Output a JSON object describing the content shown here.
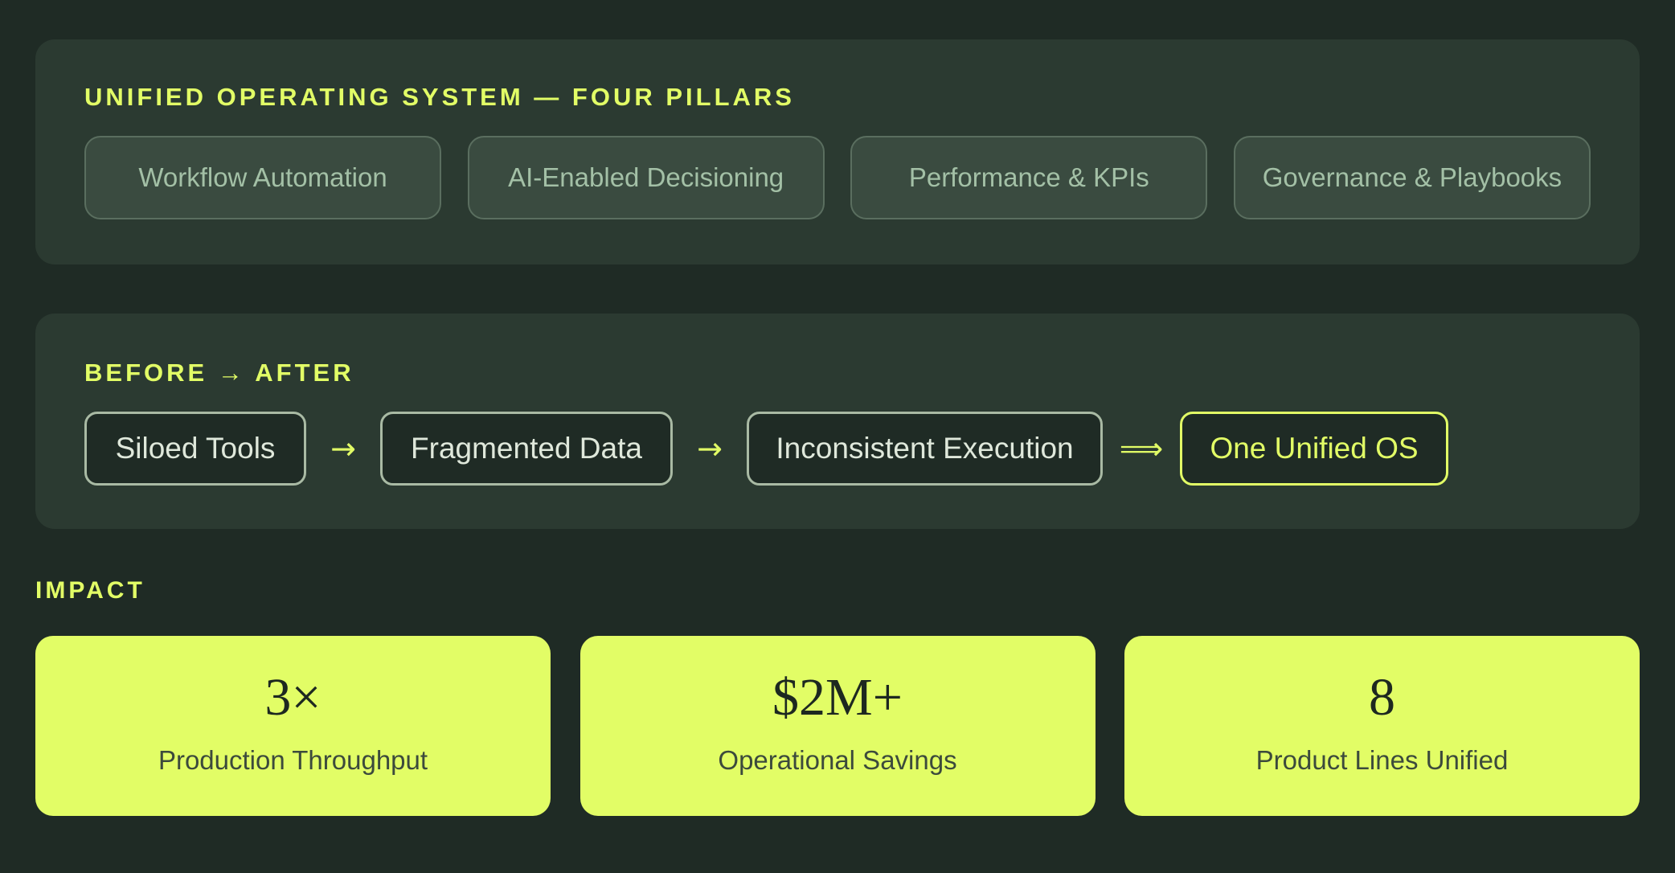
{
  "pillars": {
    "title": "UNIFIED OPERATING SYSTEM — FOUR PILLARS",
    "items": [
      "Workflow Automation",
      "AI-Enabled Decisioning",
      "Performance & KPIs",
      "Governance & Playbooks"
    ]
  },
  "before_after": {
    "title": "BEFORE → AFTER",
    "steps": [
      "Siloed Tools",
      "Fragmented Data",
      "Inconsistent Execution",
      "One Unified OS"
    ],
    "arrows": [
      "→",
      "→",
      "⟹"
    ]
  },
  "impact": {
    "title": "IMPACT",
    "metrics": [
      {
        "value": "3×",
        "label": "Production Throughput"
      },
      {
        "value": "$2M+",
        "label": "Operational Savings"
      },
      {
        "value": "8",
        "label": "Product Lines Unified"
      }
    ]
  },
  "colors": {
    "background": "#1f2b25",
    "panel": "#2b3a31",
    "accent": "#e2fd66",
    "pillar_fill": "#3a4b40",
    "pillar_text": "#a3c0a6"
  }
}
